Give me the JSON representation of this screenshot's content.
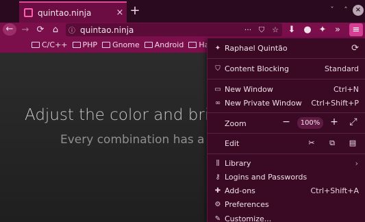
{
  "tab": {
    "title": "quintao.ninja",
    "close": "×"
  },
  "newtab": "+",
  "window_controls": {
    "minimize": "ˇ",
    "maximize": "˄",
    "close": "×"
  },
  "nav": {
    "back": "←",
    "forward": "→",
    "reload": "⟳",
    "home": "⌂"
  },
  "urlbar": {
    "info": "ⓘ",
    "url": "quintao.ninja",
    "more": "···",
    "pocket": "⛉",
    "bookmark": "☆"
  },
  "toolbar": {
    "download": "⬇",
    "extension1": "●",
    "extension2": "✦",
    "overflow": "»",
    "menu": "≡"
  },
  "bookmarks": [
    "C/C++",
    "PHP",
    "Gnome",
    "Android",
    "Haske"
  ],
  "page": {
    "title": "Adjust the color and brigh",
    "subtitle": "Every combination has a pe"
  },
  "menu": {
    "account": {
      "name": "Raphael Quintão",
      "sync": "⟳"
    },
    "content_blocking": {
      "label": "Content Blocking",
      "value": "Standard"
    },
    "new_window": {
      "label": "New Window",
      "shortcut": "Ctrl+N"
    },
    "new_private": {
      "label": "New Private Window",
      "shortcut": "Ctrl+Shift+P"
    },
    "zoom": {
      "label": "Zoom",
      "minus": "−",
      "value": "100%",
      "plus": "+",
      "full": "⤢"
    },
    "edit": {
      "label": "Edit",
      "cut": "✂",
      "copy": "⧉",
      "paste": "▤"
    },
    "library": {
      "label": "Library",
      "chevron": "›"
    },
    "logins": {
      "label": "Logins and Passwords"
    },
    "addons": {
      "label": "Add-ons",
      "shortcut": "Ctrl+Shift+A"
    },
    "preferences": {
      "label": "Preferences"
    },
    "customize": {
      "label": "Customize..."
    }
  },
  "colors": {
    "accent": "#d43f93",
    "toolbar": "#7a0f4c",
    "panel": "#3a0a25"
  }
}
